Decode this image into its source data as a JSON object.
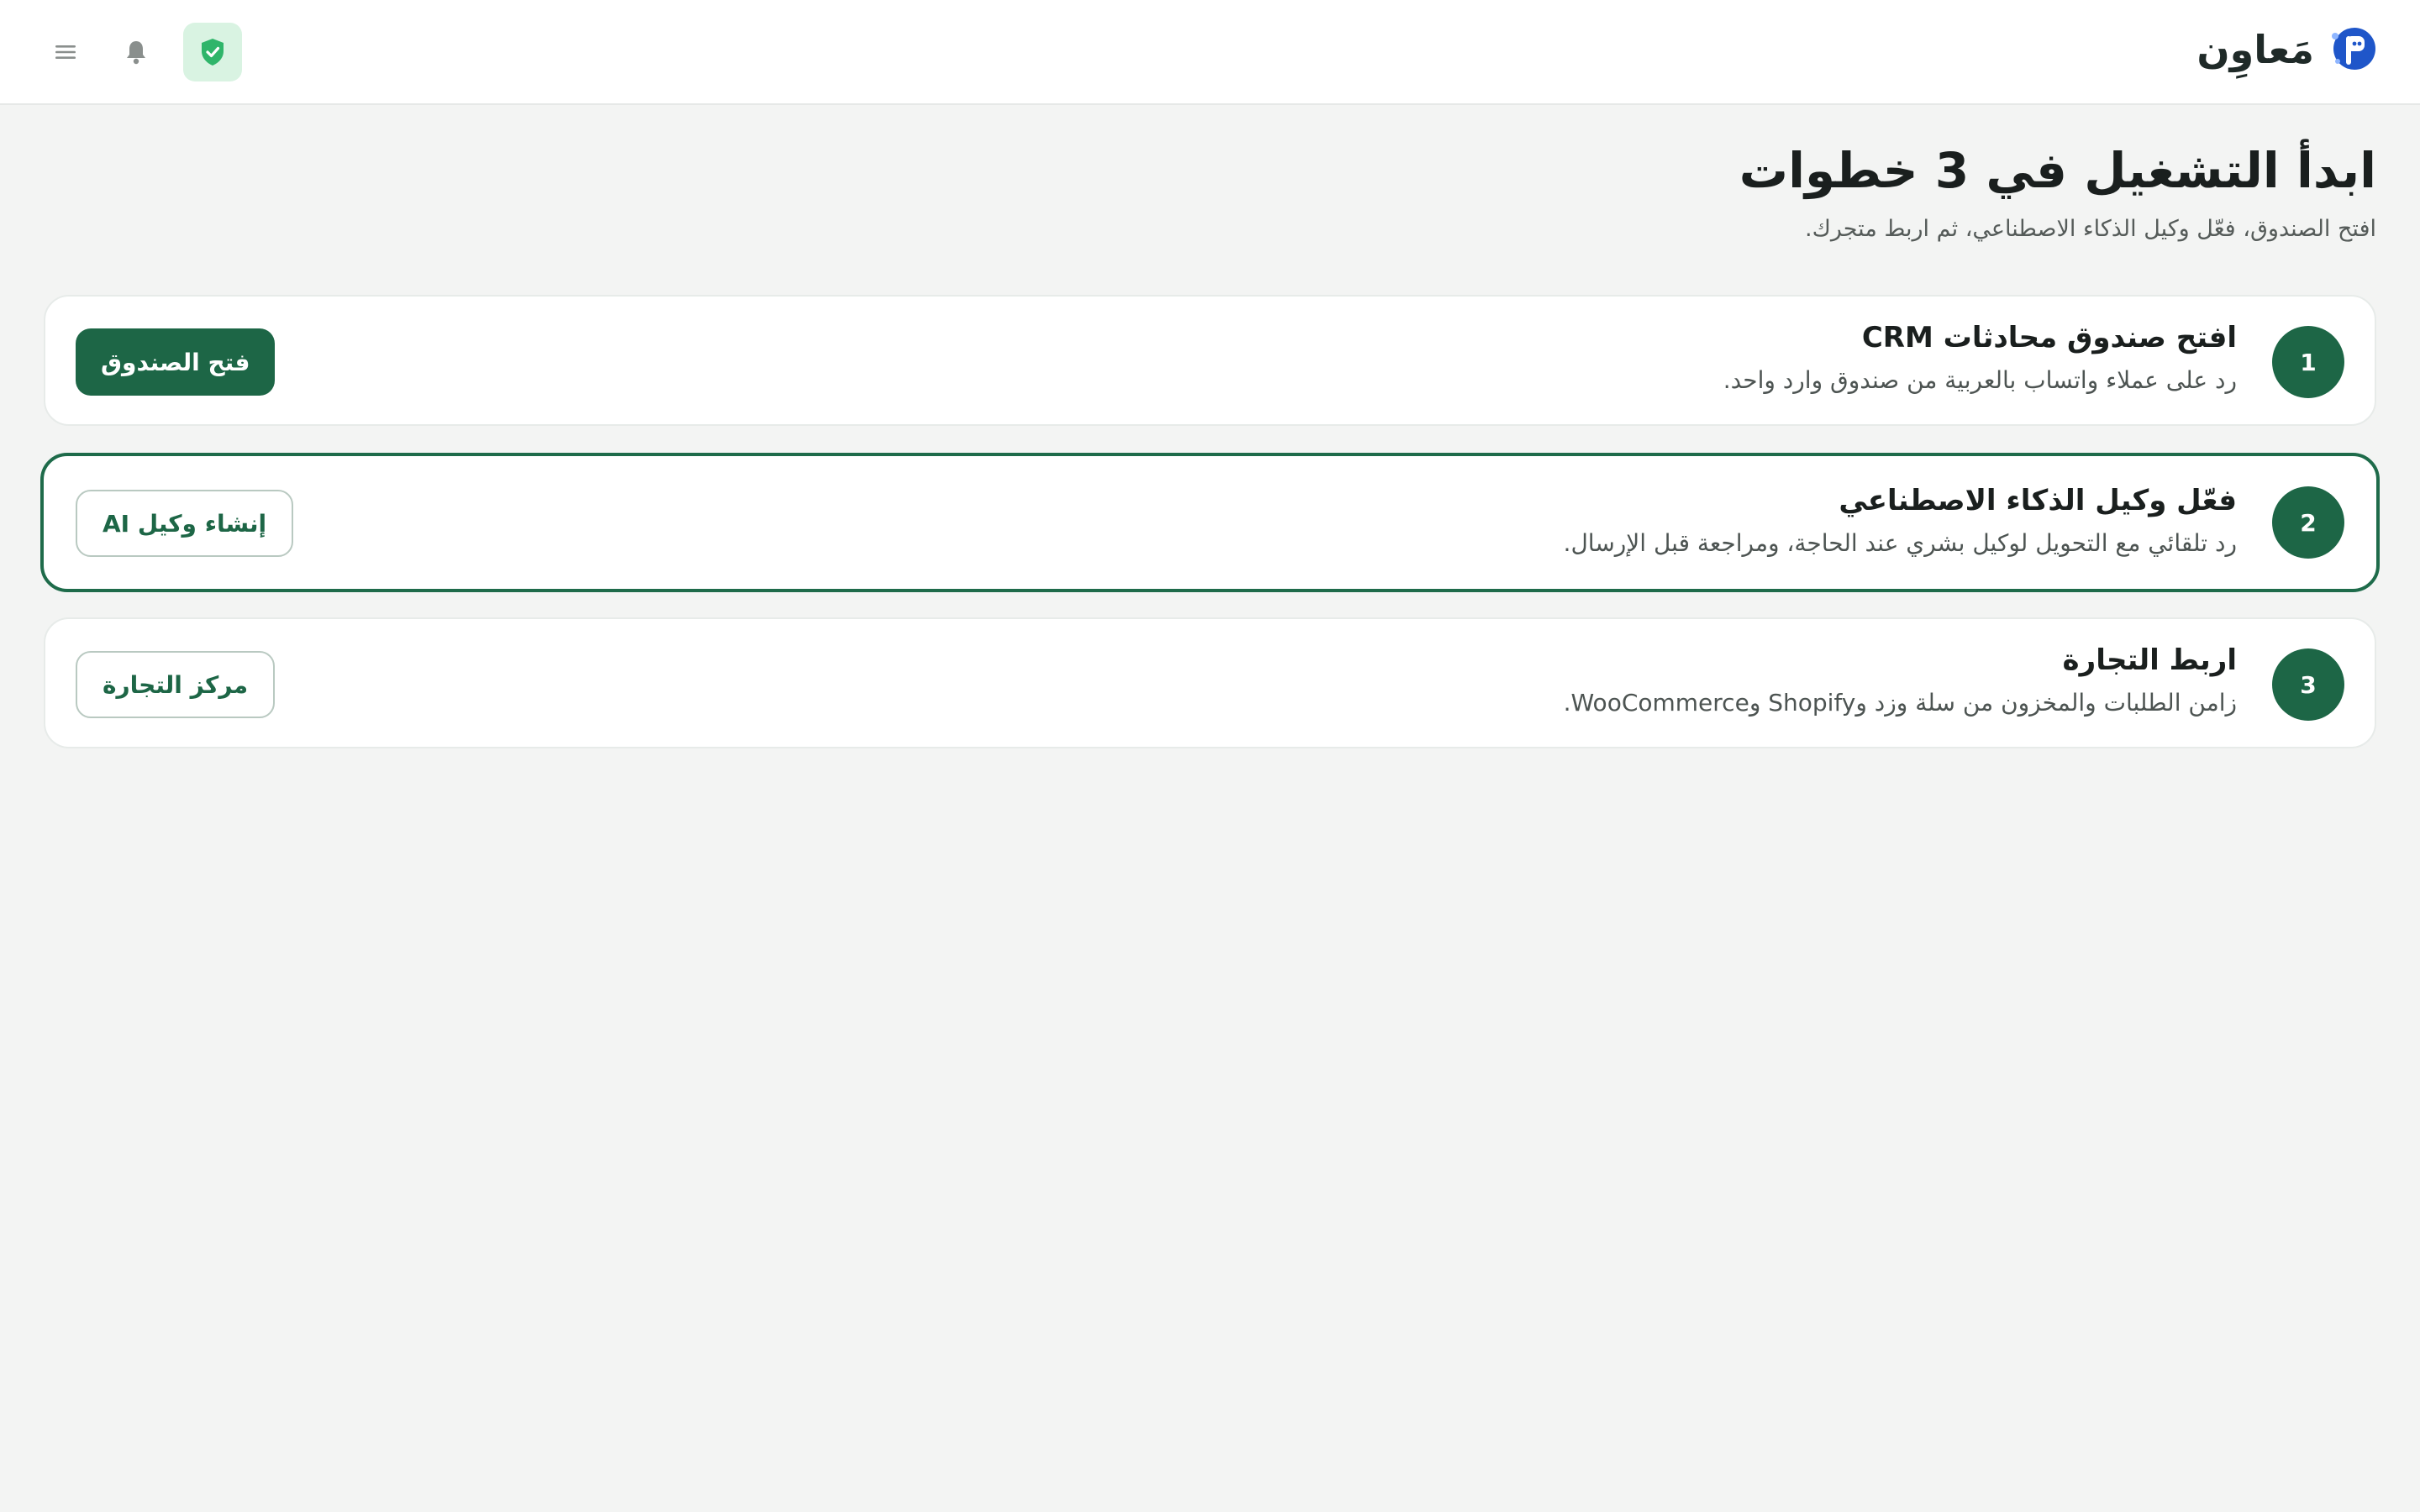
{
  "header": {
    "brand_name": "مَعاوِن",
    "brand_logo_letter": "P",
    "menu_icon": "menu-icon",
    "notification_icon": "bell-icon",
    "security_icon": "shield-check-icon"
  },
  "page": {
    "title": "ابدأ التشغيل في 3 خطوات",
    "subtitle": "افتح الصندوق، فعّل وكيل الذكاء الاصطناعي، ثم اربط متجرك."
  },
  "steps": [
    {
      "number": "1",
      "title": "افتح صندوق محادثات CRM",
      "description": "رد على عملاء واتساب بالعربية من صندوق وارد واحد.",
      "button_label": "فتح الصندوق",
      "button_style": "primary"
    },
    {
      "number": "2",
      "title": "فعّل وكيل الذكاء الاصطناعي",
      "description": "رد تلقائي مع التحويل لوكيل بشري عند الحاجة، ومراجعة قبل الإرسال.",
      "button_label": "إنشاء وكيل AI",
      "button_style": "outline",
      "active": true
    },
    {
      "number": "3",
      "title": "اربط التجارة",
      "description": "زامن الطلبات والمخزون من سلة وزد وShopify وWooCommerce.",
      "button_label": "مركز التجارة",
      "button_style": "outline"
    }
  ],
  "colors": {
    "accent": "#1d6646",
    "background": "#f3f4f3",
    "shield_bg": "#d9f3e2",
    "shield_fg": "#2fb56a",
    "logo_blue": "#1f56c9"
  }
}
